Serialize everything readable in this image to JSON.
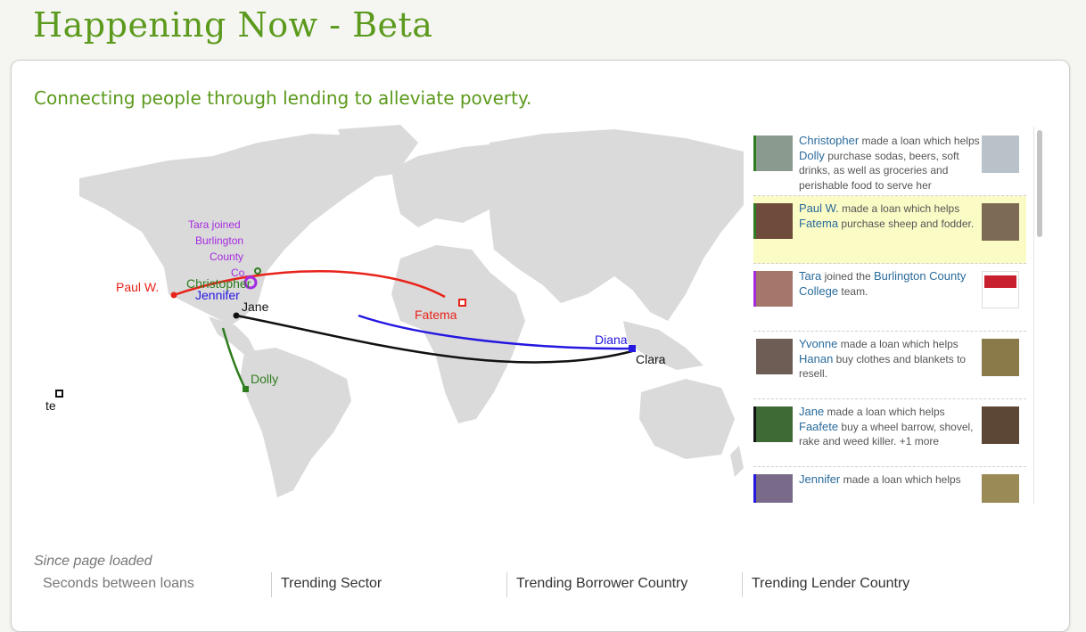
{
  "header": {
    "title": "Happening Now - Beta"
  },
  "main": {
    "tagline": "Connecting people through lending to alleviate poverty."
  },
  "map": {
    "labels": {
      "paul": "Paul W.",
      "christopher": "Christopher",
      "jennifer": "Jennifer",
      "jane": "Jane",
      "fatema": "Fatema",
      "diana": "Diana",
      "clara": "Clara",
      "dolly": "Dolly",
      "te": "te",
      "tara_line1": "Tara joined",
      "tara_line2": "Burlington",
      "tara_line3": "County",
      "tara_line4": "Co..."
    },
    "colors": {
      "land": "#dadada",
      "red": "#e8231a",
      "green": "#2e7d1f",
      "blue": "#2417e0",
      "black": "#111111",
      "purple": "#a52be0"
    }
  },
  "feed": {
    "items": [
      {
        "actor": "Christopher",
        "pre": " made a loan which helps ",
        "target": "Dolly",
        "post": " purchase sodas, beers, soft drinks, as well as groceries and perishable food to serve her customers.",
        "highlight": false,
        "left_thumb": "photo-thumbnail",
        "right_thumb": "photo-thumbnail"
      },
      {
        "actor": "Paul W.",
        "pre": " made a loan which helps ",
        "target": "Fatema",
        "post": " purchase sheep and fodder.",
        "highlight": true,
        "left_thumb": "photo-thumbnail",
        "right_thumb": "photo-thumbnail"
      },
      {
        "actor": "Tara",
        "pre": " joined the ",
        "target": "Burlington County College",
        "post": " team.",
        "highlight": false,
        "left_thumb": "photo-thumbnail",
        "right_thumb": "team-logo"
      },
      {
        "actor": "Yvonne",
        "pre": " made a loan which helps ",
        "target": "Hanan",
        "post": " buy clothes and blankets to resell.",
        "highlight": false,
        "left_thumb": "photo-thumbnail",
        "right_thumb": "photo-thumbnail"
      },
      {
        "actor": "Jane",
        "pre": " made a loan which helps ",
        "target": "Faafete",
        "post": " buy a wheel barrow, shovel, rake and weed killer. +1 more",
        "highlight": false,
        "left_thumb": "photo-thumbnail",
        "right_thumb": "photo-thumbnail"
      },
      {
        "actor": "Jennifer",
        "pre": " made a loan which helps ",
        "target": "",
        "post": "",
        "highlight": false,
        "left_thumb": "photo-thumbnail",
        "right_thumb": "photo-thumbnail"
      }
    ]
  },
  "stats": {
    "since_label": "Since page loaded",
    "columns": [
      "Seconds between loans",
      "Trending Sector",
      "Trending Borrower Country",
      "Trending Lender Country"
    ]
  }
}
